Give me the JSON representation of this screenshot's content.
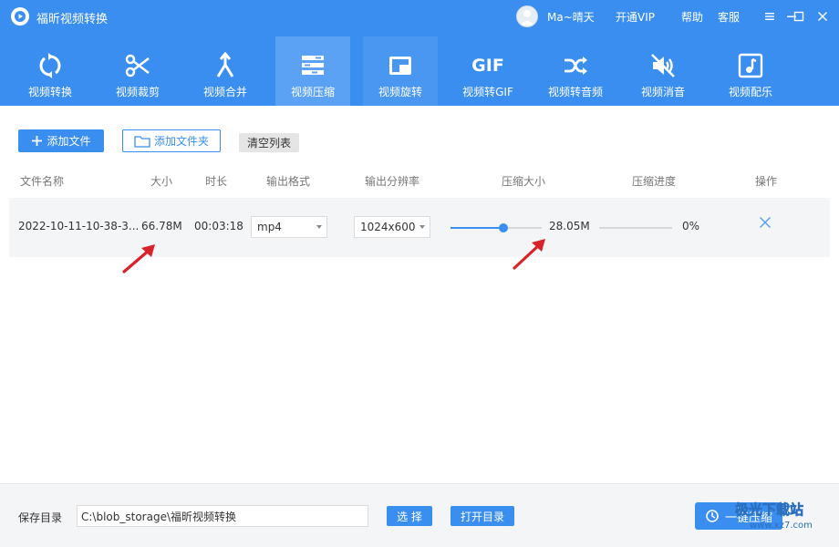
{
  "app": {
    "title": "福昕视频转换",
    "user_name": "Ma~晴天",
    "vip_label": "开通VIP",
    "help_label": "帮助",
    "service_label": "客服"
  },
  "toolbar": {
    "items": [
      {
        "label": "视频转换",
        "icon": "refresh-icon"
      },
      {
        "label": "视频裁剪",
        "icon": "scissors-icon"
      },
      {
        "label": "视频合并",
        "icon": "merge-icon"
      },
      {
        "label": "视频压缩",
        "icon": "compress-icon"
      },
      {
        "label": "视频旋转",
        "icon": "rotate-icon"
      },
      {
        "label": "视频转GIF",
        "icon": "gif-icon"
      },
      {
        "label": "视频转音频",
        "icon": "shuffle-icon"
      },
      {
        "label": "视频消音",
        "icon": "mute-icon"
      },
      {
        "label": "视频配乐",
        "icon": "music-note-icon"
      }
    ],
    "active_index": 3,
    "gif_text": "GIF"
  },
  "actions": {
    "add_file": "添加文件",
    "add_folder": "添加文件夹",
    "clear_list": "清空列表"
  },
  "table": {
    "headers": {
      "name": "文件名称",
      "size": "大小",
      "duration": "时长",
      "format": "输出格式",
      "resolution": "输出分辨率",
      "compressed_size": "压缩大小",
      "progress": "压缩进度",
      "action": "操作"
    },
    "rows": [
      {
        "name": "2022-10-11-10-38-3...",
        "size": "66.78M",
        "duration": "00:03:18",
        "format": "mp4",
        "resolution": "1024x600",
        "compression_level": 0.58,
        "compressed_size": "28.05M",
        "progress_percent": 0,
        "progress_text": "0%"
      }
    ]
  },
  "footer": {
    "save_dir_label": "保存目录",
    "save_path": "C:\\blob_storage\\福昕视频转换",
    "choose_label": "选 择",
    "open_dir_label": "打开目录",
    "compress_label": "一键压缩",
    "watermark_text": "极光下载站",
    "watermark_url": "www.xz7.com"
  },
  "colors": {
    "primary": "#3a8ef0",
    "active_tab": "#5ba2f4",
    "arrow_red": "#d9232a"
  }
}
